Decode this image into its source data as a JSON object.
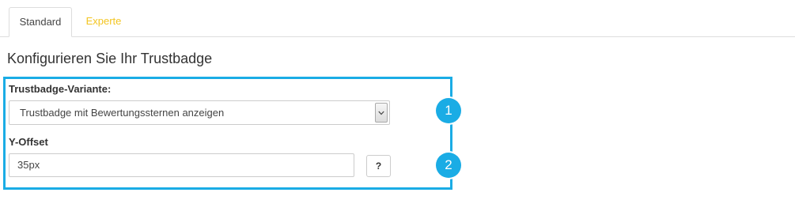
{
  "tabs": [
    {
      "label": "Standard",
      "active": true
    },
    {
      "label": "Experte",
      "active": false
    }
  ],
  "heading": "Konfigurieren Sie Ihr Trustbadge",
  "form": {
    "variant_label": "Trustbadge-Variante:",
    "variant_value": "Trustbadge mit Bewertungssternen anzeigen",
    "offset_label": "Y-Offset",
    "offset_value": "35px",
    "help_label": "?"
  },
  "badges": [
    "1",
    "2"
  ],
  "colors": {
    "accent": "#1aace5",
    "inactive_tab": "#f3c521",
    "text": "#333333",
    "border": "#cccccc"
  },
  "icons": {
    "select_arrow": "chevron-down-icon"
  }
}
